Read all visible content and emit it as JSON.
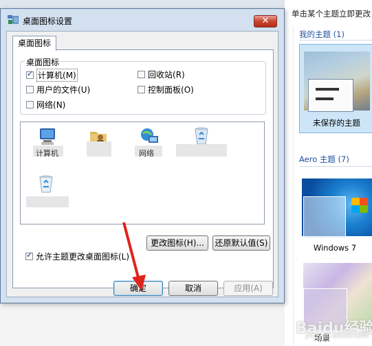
{
  "dialog": {
    "title": "桌面图标设置",
    "close_label": "✕",
    "tab_label": "桌面图标",
    "group_title": "桌面图标",
    "checkboxes": [
      {
        "label": "计算机",
        "shortcut": "(M)",
        "checked": true
      },
      {
        "label": "回收站",
        "shortcut": "(R)",
        "checked": false
      },
      {
        "label": "用户的文件",
        "shortcut": "(U)",
        "checked": false
      },
      {
        "label": "控制面板",
        "shortcut": "(O)",
        "checked": false
      },
      {
        "label": "网络",
        "shortcut": "(N)",
        "checked": false
      }
    ],
    "icons": [
      {
        "label": "计算机",
        "icon": "computer-icon"
      },
      {
        "label": "",
        "icon": "user-folder-icon"
      },
      {
        "label": "网络",
        "icon": "network-icon"
      },
      {
        "label": "",
        "icon": "recycle-bin-full-icon"
      },
      {
        "label": "",
        "icon": "recycle-bin-empty-icon"
      }
    ],
    "change_icon_label": "更改图标(H)...",
    "restore_default_label": "还原默认值(S)",
    "allow_themes_label": "允许主题更改桌面图标(L)",
    "allow_themes_checked": true,
    "ok_label": "确定",
    "cancel_label": "取消",
    "apply_label": "应用(A)"
  },
  "background_panel": {
    "header": "单击某个主题立即更改",
    "my_themes_title": "我的主题 (1)",
    "my_theme_label": "未保存的主题",
    "aero_title": "Aero 主题 (7)",
    "aero_themes": [
      "Windows 7",
      "场景"
    ]
  },
  "watermark": {
    "text": "Baidu经验",
    "sub": "jingyan.baidu.com"
  },
  "colors": {
    "accent_arrow": "#e0241b",
    "link_blue": "#1e4f9c",
    "close_red": "#c9452f"
  }
}
